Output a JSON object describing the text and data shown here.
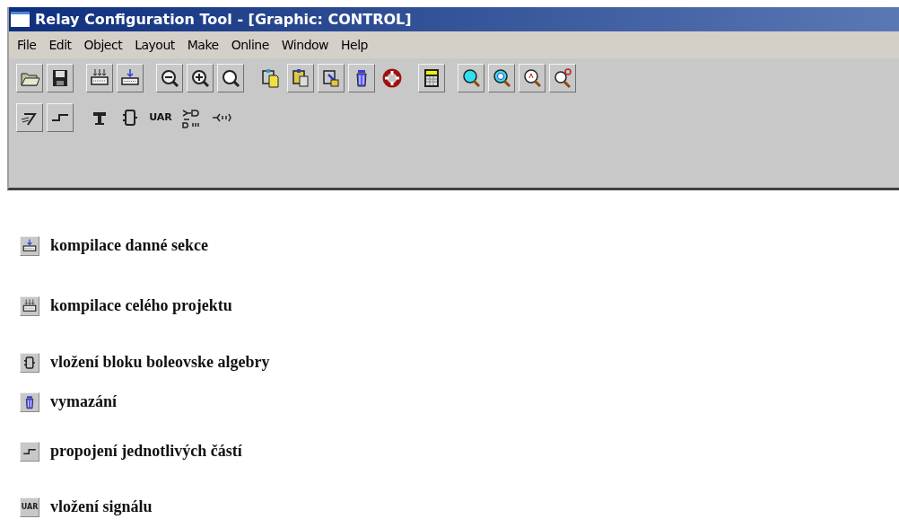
{
  "window": {
    "title": "Relay Configuration Tool - [Graphic: CONTROL]"
  },
  "menu": [
    "File",
    "Edit",
    "Object",
    "Layout",
    "Make",
    "Online",
    "Window",
    "Help"
  ],
  "toolbar": {
    "rows": [
      [
        [
          {
            "kind": "open",
            "raised": true
          },
          {
            "kind": "save",
            "raised": true
          }
        ],
        [
          {
            "kind": "compile-all",
            "raised": true
          },
          {
            "kind": "compile-section",
            "raised": true
          }
        ],
        [
          {
            "kind": "zoom-out",
            "raised": true
          },
          {
            "kind": "zoom-in",
            "raised": true
          },
          {
            "kind": "zoom-fit",
            "raised": true
          }
        ],
        [
          {
            "kind": "copy",
            "raised": false
          },
          {
            "kind": "paste",
            "raised": true
          },
          {
            "kind": "edit",
            "raised": true
          },
          {
            "kind": "trash",
            "raised": true
          },
          {
            "kind": "lifebuoy",
            "raised": false
          }
        ],
        [
          {
            "kind": "calculator",
            "raised": true
          }
        ],
        [
          {
            "kind": "find-cyan",
            "raised": true
          },
          {
            "kind": "find-r",
            "raised": true
          },
          {
            "kind": "find-a",
            "raised": true
          },
          {
            "kind": "find-or",
            "raised": true
          }
        ]
      ],
      [
        [
          {
            "kind": "pen",
            "raised": true
          },
          {
            "kind": "step",
            "raised": true
          }
        ],
        [
          {
            "kind": "tee",
            "raised": false
          },
          {
            "kind": "block",
            "raised": false
          },
          {
            "kind": "text",
            "text": "UAR",
            "raised": false
          },
          {
            "kind": "gate",
            "raised": false
          },
          {
            "kind": "signal",
            "raised": false
          }
        ]
      ]
    ]
  },
  "legend": [
    {
      "kind": "compile-section",
      "text": "kompilace danné sekce"
    },
    {
      "kind": "compile-all",
      "text": "kompilace celého projektu"
    },
    {
      "kind": "block",
      "text": "vložení bloku boleovske algebry"
    },
    {
      "kind": "trash",
      "text": "vymazání"
    },
    {
      "kind": "step",
      "text": "propojení jednotlivých částí"
    },
    {
      "kind": "text",
      "icon_text": "UAR",
      "text": "vložení signálu"
    }
  ]
}
